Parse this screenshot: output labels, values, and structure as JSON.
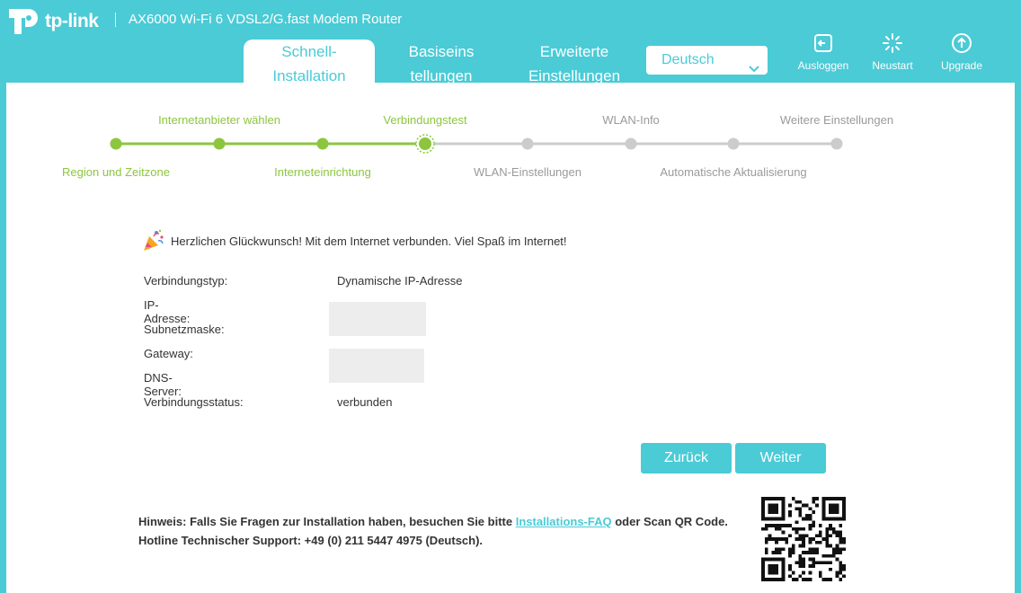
{
  "header": {
    "brand": "tp-link",
    "model": "AX6000 Wi-Fi 6 VDSL2/G.fast Modem Router"
  },
  "tabs": [
    {
      "line1": "Schnell-",
      "line2": "Installation"
    },
    {
      "line1": "Basiseins",
      "line2": "tellungen"
    },
    {
      "line1": "Erweiterte",
      "line2": "Einstellungen"
    }
  ],
  "language": {
    "selected": "Deutsch"
  },
  "tools": {
    "logout": "Ausloggen",
    "reboot": "Neustart",
    "upgrade": "Upgrade"
  },
  "steps": [
    {
      "label": "Region und Zeitzone",
      "status": "done"
    },
    {
      "label": "Internetanbieter wählen",
      "status": "done"
    },
    {
      "label": "Interneteinrichtung",
      "status": "done"
    },
    {
      "label": "Verbindungstest",
      "status": "current"
    },
    {
      "label": "WLAN-Einstellungen",
      "status": "todo"
    },
    {
      "label": "WLAN-Info",
      "status": "todo"
    },
    {
      "label": "Automatische Aktualisierung",
      "status": "todo"
    },
    {
      "label": "Weitere Einstellungen",
      "status": "todo"
    }
  ],
  "colors": {
    "accent": "#4acbd6",
    "done": "#8cc63f",
    "todo": "#cccccc"
  },
  "result": {
    "congrats": "Herzlichen Glückwunsch! Mit dem Internet verbunden. Viel Spaß im Internet!",
    "rows": [
      {
        "label": "Verbindungstyp:",
        "value": "Dynamische IP-Adresse"
      },
      {
        "label": "IP-Adresse:",
        "value": ""
      },
      {
        "label": "Subnetzmaske:",
        "value": ""
      },
      {
        "label": "Gateway:",
        "value": ""
      },
      {
        "label": "DNS-Server:",
        "value": ""
      },
      {
        "label": "Verbindungsstatus:",
        "value": "verbunden"
      }
    ]
  },
  "buttons": {
    "back": "Zurück",
    "next": "Weiter"
  },
  "hint": {
    "prefix": "Hinweis: Falls Sie Fragen zur Installation haben, besuchen Sie bitte ",
    "link": "Installations-FAQ",
    "suffix": " oder Scan QR Code.",
    "hotline": "Hotline Technischer Support: +49 (0) 211 5447 4975 (Deutsch)."
  }
}
